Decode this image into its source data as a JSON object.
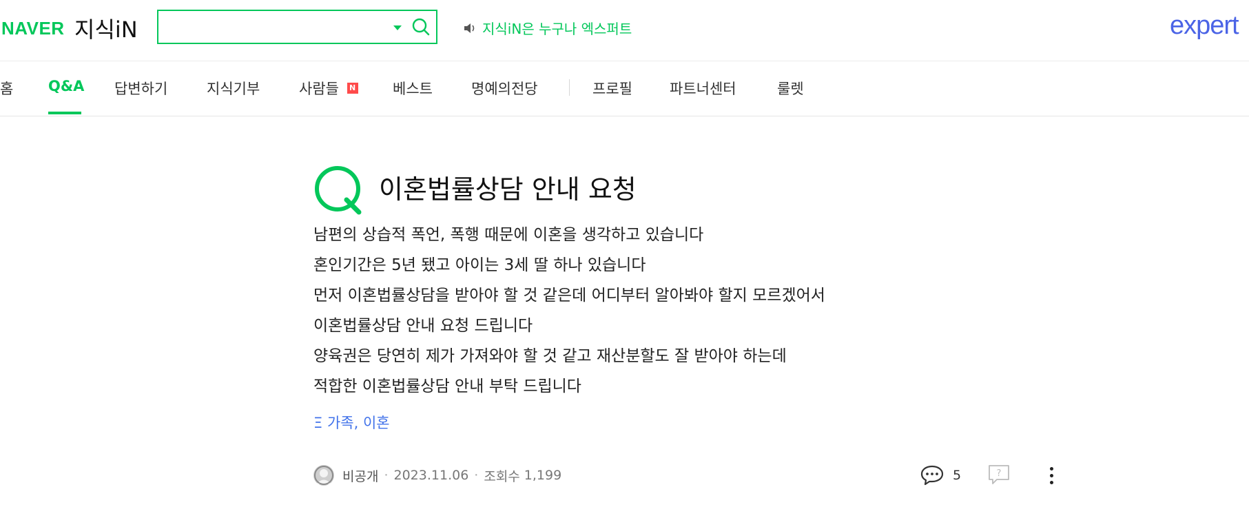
{
  "header": {
    "naver_logo": "NAVER",
    "service_logo": "지식iN",
    "search": {
      "value": "",
      "placeholder": ""
    },
    "notice": "지식iN은 누구나 엑스퍼트",
    "expert_logo": "expert",
    "accent_color": "#03c75a",
    "expert_color": "#4b64e6"
  },
  "nav": {
    "items": [
      {
        "label": "홈"
      },
      {
        "label": "Q&A",
        "active": true
      },
      {
        "label": "답변하기"
      },
      {
        "label": "지식기부"
      },
      {
        "label": "사람들",
        "badge": "N"
      },
      {
        "label": "베스트"
      },
      {
        "label": "명예의전당"
      },
      {
        "label": "프로필"
      },
      {
        "label": "파트너센터"
      },
      {
        "label": "룰렛"
      }
    ]
  },
  "question": {
    "icon": "q-icon",
    "title": "이혼법률상담 안내 요청",
    "body": [
      "남편의 상습적 폭언, 폭행 때문에 이혼을 생각하고 있습니다",
      "혼인기간은 5년 됐고 아이는 3세 딸 하나 있습니다",
      "먼저 이혼법률상담을 받아야 할 것 같은데 어디부터 알아봐야 할지 모르겠어서",
      "이혼법률상담 안내 요청 드립니다",
      "양육권은 당연히 제가 가져와야 할 것 같고 재산분할도 잘 받아야 하는데",
      "적합한 이혼법률상담 안내 부탁 드립니다"
    ],
    "tag": "가족, 이혼",
    "tag_icon_glyph": "Ξ"
  },
  "meta": {
    "author": "비공개",
    "date": "2023.11.06",
    "views_label": "조회수",
    "views": "1,199",
    "comment_count": "5"
  }
}
